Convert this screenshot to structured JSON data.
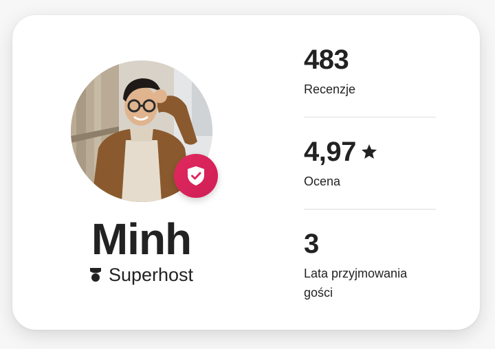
{
  "host": {
    "name": "Minh",
    "badge": "Superhost",
    "avatar_alt": "host-photo"
  },
  "stats": {
    "reviews": {
      "value": "483",
      "label": "Recenzje"
    },
    "rating": {
      "value": "4,97",
      "label": "Ocena",
      "icon": "star-icon"
    },
    "years": {
      "value": "3",
      "label": "Lata przyjmowania gości"
    }
  },
  "colors": {
    "accent": "#e0295e",
    "text": "#222222",
    "divider": "#dddddd",
    "card": "#ffffff"
  }
}
